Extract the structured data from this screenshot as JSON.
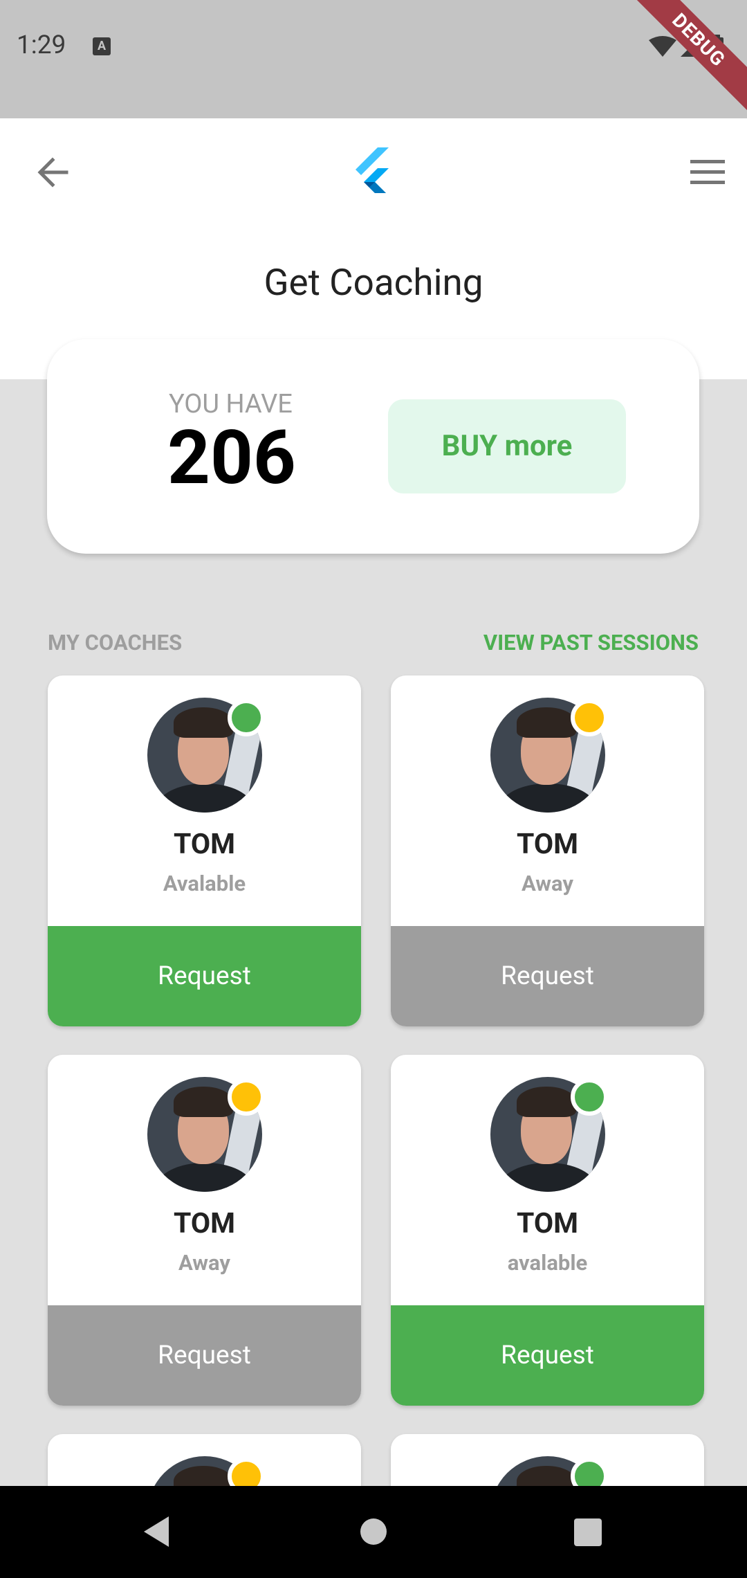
{
  "status_bar": {
    "time": "1:29",
    "notification_icon_letter": "A",
    "debug_banner": "DEBUG"
  },
  "header": {
    "title": "Get Coaching",
    "back_icon": "arrow-left-icon",
    "logo_icon": "flutter-logo",
    "menu_icon": "hamburger-menu-icon"
  },
  "credits": {
    "label": "YOU HAVE",
    "value": "206",
    "buy_label": "BUY more"
  },
  "coaches_section": {
    "title": "MY COACHES",
    "view_past_label": "VIEW PAST SESSIONS"
  },
  "colors": {
    "available": "#4caf50",
    "away": "#ffc107",
    "button_available": "#4caf50",
    "button_away": "#9e9e9e",
    "accent_green": "#4caf50"
  },
  "coaches": [
    {
      "name": "TOM",
      "status": "Avalable",
      "state": "available",
      "request_label": "Request"
    },
    {
      "name": "TOM",
      "status": "Away",
      "state": "away",
      "request_label": "Request"
    },
    {
      "name": "TOM",
      "status": "Away",
      "state": "away",
      "request_label": "Request"
    },
    {
      "name": "TOM",
      "status": "avalable",
      "state": "available",
      "request_label": "Request"
    },
    {
      "name": "",
      "status": "",
      "state": "away",
      "request_label": ""
    },
    {
      "name": "",
      "status": "",
      "state": "available",
      "request_label": ""
    }
  ]
}
